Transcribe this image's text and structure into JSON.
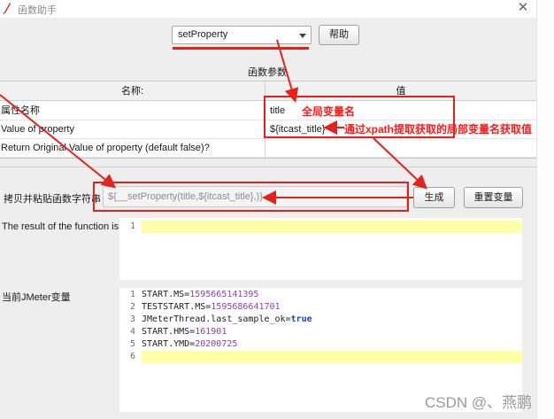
{
  "window": {
    "title": "函数助手",
    "close_glyph": "✕"
  },
  "function_select": {
    "selected": "setProperty"
  },
  "help_button": "帮助",
  "params_section": "函数参数",
  "table": {
    "headers": {
      "name": "名称:",
      "value": "值"
    },
    "rows": [
      {
        "name": "属性名称",
        "value": "title"
      },
      {
        "name": "Value of property",
        "value": "${itcast_title}"
      },
      {
        "name": "Return Original Value of property (default false)?",
        "value": ""
      }
    ]
  },
  "copy": {
    "label": "拷贝并粘贴函数字符串",
    "value": "${__setProperty(title,${itcast_title},)}",
    "generate_button": "生成",
    "reset_button": "重置变量"
  },
  "result": {
    "label": "The result of the function is",
    "line_numbers": [
      "1"
    ]
  },
  "jmeter_vars": {
    "label": "当前JMeter变量",
    "line_numbers": [
      "1",
      "2",
      "3",
      "4",
      "5",
      "6"
    ],
    "lines": [
      {
        "key": "START.MS=",
        "value": "1595665141395"
      },
      {
        "key": "TESTSTART.MS=",
        "value": "1595686641701"
      },
      {
        "key": "JMeterThread.last_sample_ok=",
        "value": "true"
      },
      {
        "key": "START.HMS=",
        "value": "161901"
      },
      {
        "key": "START.YMD=",
        "value": "20200725"
      }
    ]
  },
  "annotations": {
    "global_var": "全局变量名",
    "xpath_note": "通过xpath提取获取的局部变量名获取值",
    "color": "#e8201a"
  },
  "watermark": "CSDN @、燕鹏",
  "icons": {
    "title": "feather-icon",
    "close": "close-icon",
    "dropdown": "chevron-down-icon"
  }
}
